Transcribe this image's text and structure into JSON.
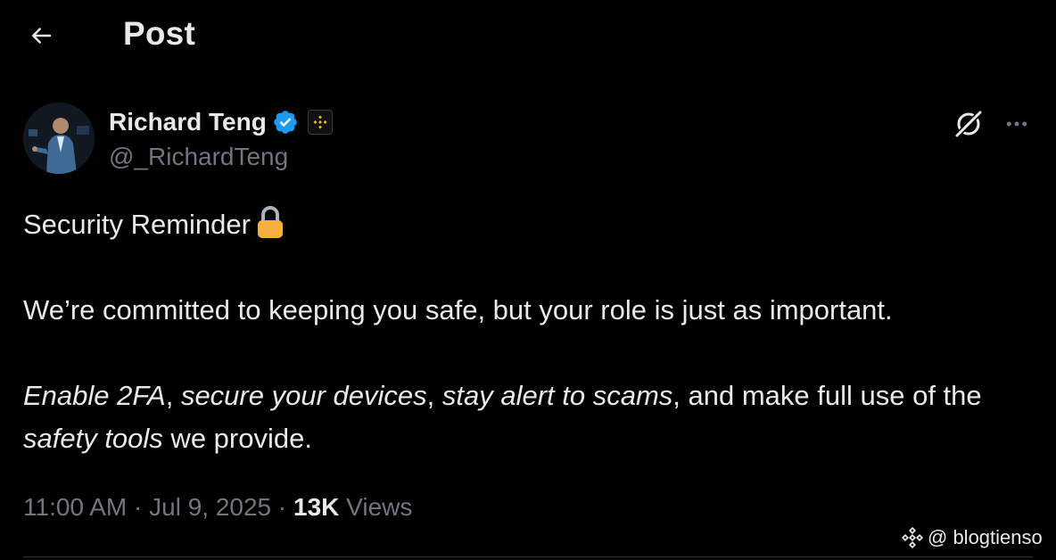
{
  "header": {
    "back_icon": "arrow-left-icon",
    "title": "Post"
  },
  "author": {
    "display_name": "Richard Teng",
    "handle": "@_RichardTeng",
    "verified": true,
    "verified_color": "#1d9bf0",
    "affiliate_badge": "binance-logo",
    "affiliate_color": "#f0b90b"
  },
  "actions": {
    "grok_icon": "grok-icon",
    "more_icon": "more-horizontal-icon"
  },
  "tweet": {
    "line1": "Security Reminder",
    "line1_emoji": "lock-icon",
    "line2": "We’re committed to keeping you safe, but your role is just as important.",
    "line3_parts": {
      "p1": "Enable 2FA",
      "s1": ", ",
      "p2": "secure your devices",
      "s2": ", ",
      "p3": "stay alert to scams",
      "s3": ", and make full use of the ",
      "p4": "safety tools",
      "s4": " we provide."
    }
  },
  "meta": {
    "time": "11:00 AM",
    "separator": "·",
    "date": "Jul 9, 2025",
    "views_count": "13K",
    "views_label": "Views"
  },
  "watermark": {
    "text": "@ blogtienso"
  },
  "colors": {
    "background": "#000000",
    "text_primary": "#e7e9ea",
    "text_secondary": "#71767b",
    "lock_emoji": "#f5b042"
  }
}
